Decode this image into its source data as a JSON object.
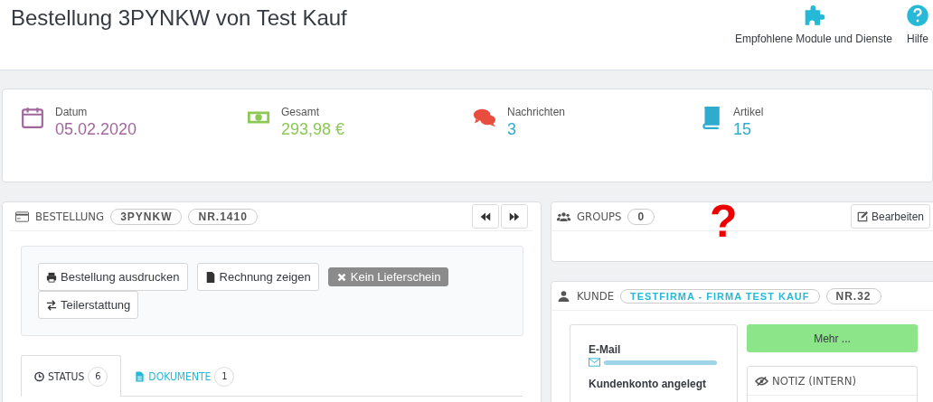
{
  "page_title": "Bestellung 3PYNKW von Test Kauf",
  "toolbar": [
    {
      "kind": "modules",
      "label": "Empfohlene Module und Dienste"
    },
    {
      "kind": "help",
      "label": "Hilfe"
    }
  ],
  "stats": [
    {
      "kind": "date",
      "label": "Datum",
      "value": "05.02.2020"
    },
    {
      "kind": "total",
      "label": "Gesamt",
      "value": "293,98 €"
    },
    {
      "kind": "messages",
      "label": "Nachrichten",
      "value": "3"
    },
    {
      "kind": "items",
      "label": "Artikel",
      "value": "15"
    }
  ],
  "order_panel": {
    "title": "BESTELLUNG",
    "reference": "3PYNKW",
    "number": "NR.1410",
    "actions": [
      {
        "kind": "print",
        "label": "Bestellung ausdrucken",
        "disabled": false
      },
      {
        "kind": "file",
        "label": "Rechnung zeigen",
        "disabled": false
      },
      {
        "kind": "close",
        "label": "Kein Lieferschein",
        "disabled": true
      },
      {
        "kind": "swap",
        "label": "Teilerstattung",
        "disabled": false
      }
    ],
    "tabs": [
      {
        "kind": "clock",
        "label": "STATUS",
        "count": "6",
        "selected": true
      },
      {
        "kind": "file",
        "label": "DOKUMENTE",
        "count": "1",
        "selected": false
      }
    ]
  },
  "groups_panel": {
    "title": "GROUPS",
    "count": "0",
    "edit_button": "Bearbeiten"
  },
  "annotation": "?",
  "customer_panel": {
    "title": "KUNDE",
    "name": "TESTFIRMA - FIRMA TEST KAUF",
    "number": "NR.32",
    "email_label": "E-Mail",
    "account_label": "Kundenkonto angelegt",
    "more_button": "Mehr ...",
    "note_title": "NOTIZ (INTERN)"
  }
}
